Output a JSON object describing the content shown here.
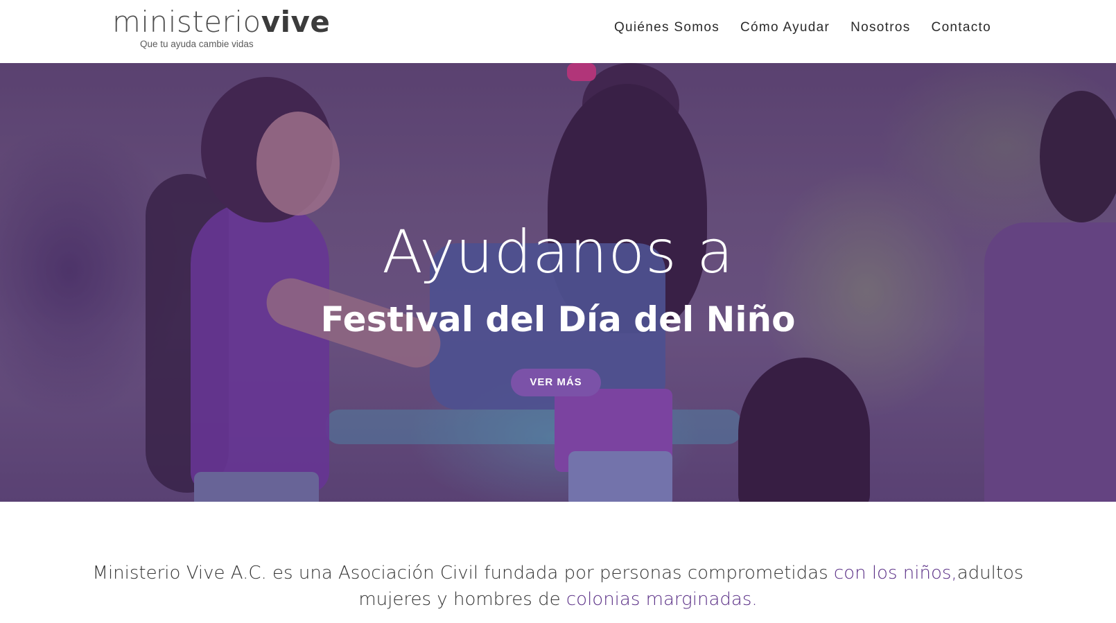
{
  "header": {
    "logo": {
      "main_thin": "ministerio",
      "main_bold": "vive",
      "tagline": "Que tu ayuda cambie vidas"
    },
    "nav": [
      {
        "label": "Quiénes Somos"
      },
      {
        "label": "Cómo Ayudar"
      },
      {
        "label": "Nosotros"
      },
      {
        "label": "Contacto"
      }
    ]
  },
  "hero": {
    "title": "Ayudanos a",
    "subtitle": "Festival del Día del Niño",
    "button_label": "VER MÁS",
    "overlay_color": "#562c78"
  },
  "intro": {
    "part1": "Ministerio Vive A.C. es una Asociación Civil fundada por personas comprometidas ",
    "highlight1": "con los niños,",
    "part2": "adultos mujeres y hombres de ",
    "highlight2": "colonias marginadas."
  },
  "colors": {
    "accent": "#5a2f86",
    "button": "#7b52a8",
    "text": "#333333"
  }
}
